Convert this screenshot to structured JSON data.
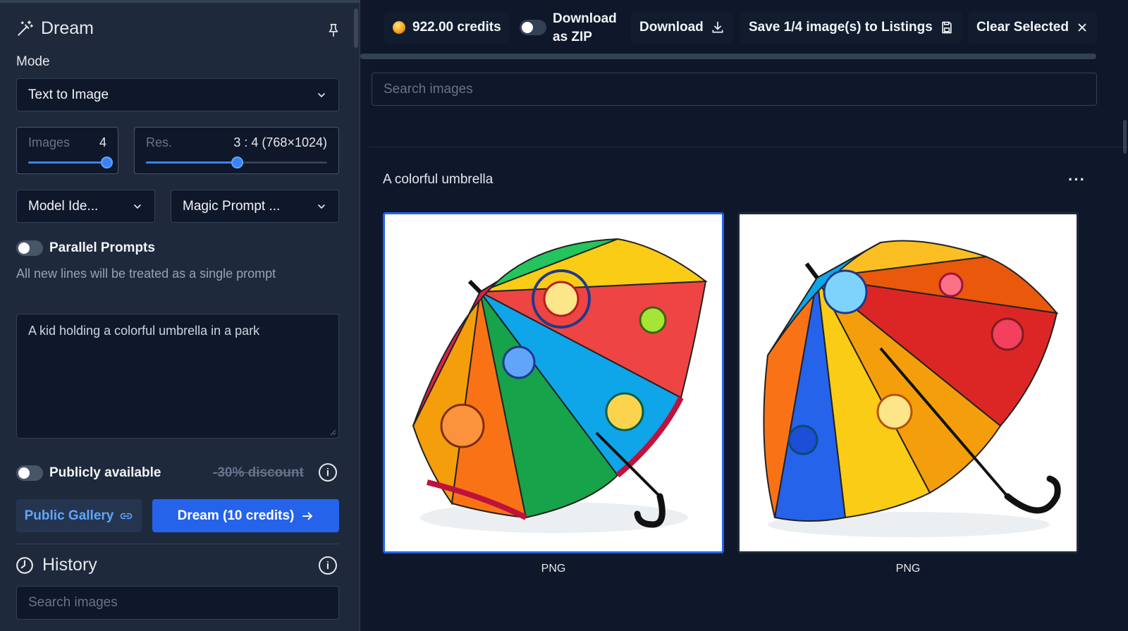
{
  "sidebar": {
    "title": "Dream",
    "mode_label": "Mode",
    "mode_value": "Text to Image",
    "images_slider": {
      "label": "Images",
      "value": "4",
      "level": 1.0
    },
    "res_slider": {
      "label": "Res.",
      "value": "3 : 4 (768×1024)",
      "level": 0.5
    },
    "model_select": "Model Ide...",
    "magic_prompt_select": "Magic Prompt ...",
    "parallel_prompts_label": "Parallel Prompts",
    "parallel_hint": "All new lines will be treated as a single prompt",
    "prompt_text": "A kid holding a colorful umbrella in a park",
    "public_label": "Publicly available",
    "discount_text": "-30% discount",
    "public_gallery_button": "Public Gallery",
    "dream_button": "Dream (10 credits)",
    "history_title": "History",
    "history_search_placeholder": "Search images"
  },
  "topbar": {
    "credits": "922.00 credits",
    "zip_label_line1": "Download",
    "zip_label_line2": "as ZIP",
    "download_button": "Download",
    "save_button": "Save 1/4 image(s) to Listings",
    "clear_button": "Clear Selected"
  },
  "main": {
    "search_placeholder": "Search images",
    "group_title": "A colorful umbrella",
    "images": [
      {
        "format": "PNG",
        "selected": true
      },
      {
        "format": "PNG",
        "selected": false
      }
    ]
  },
  "colors": {
    "accent": "#2563eb",
    "sidebar_bg": "#1e293b",
    "main_bg": "#0f172a"
  }
}
